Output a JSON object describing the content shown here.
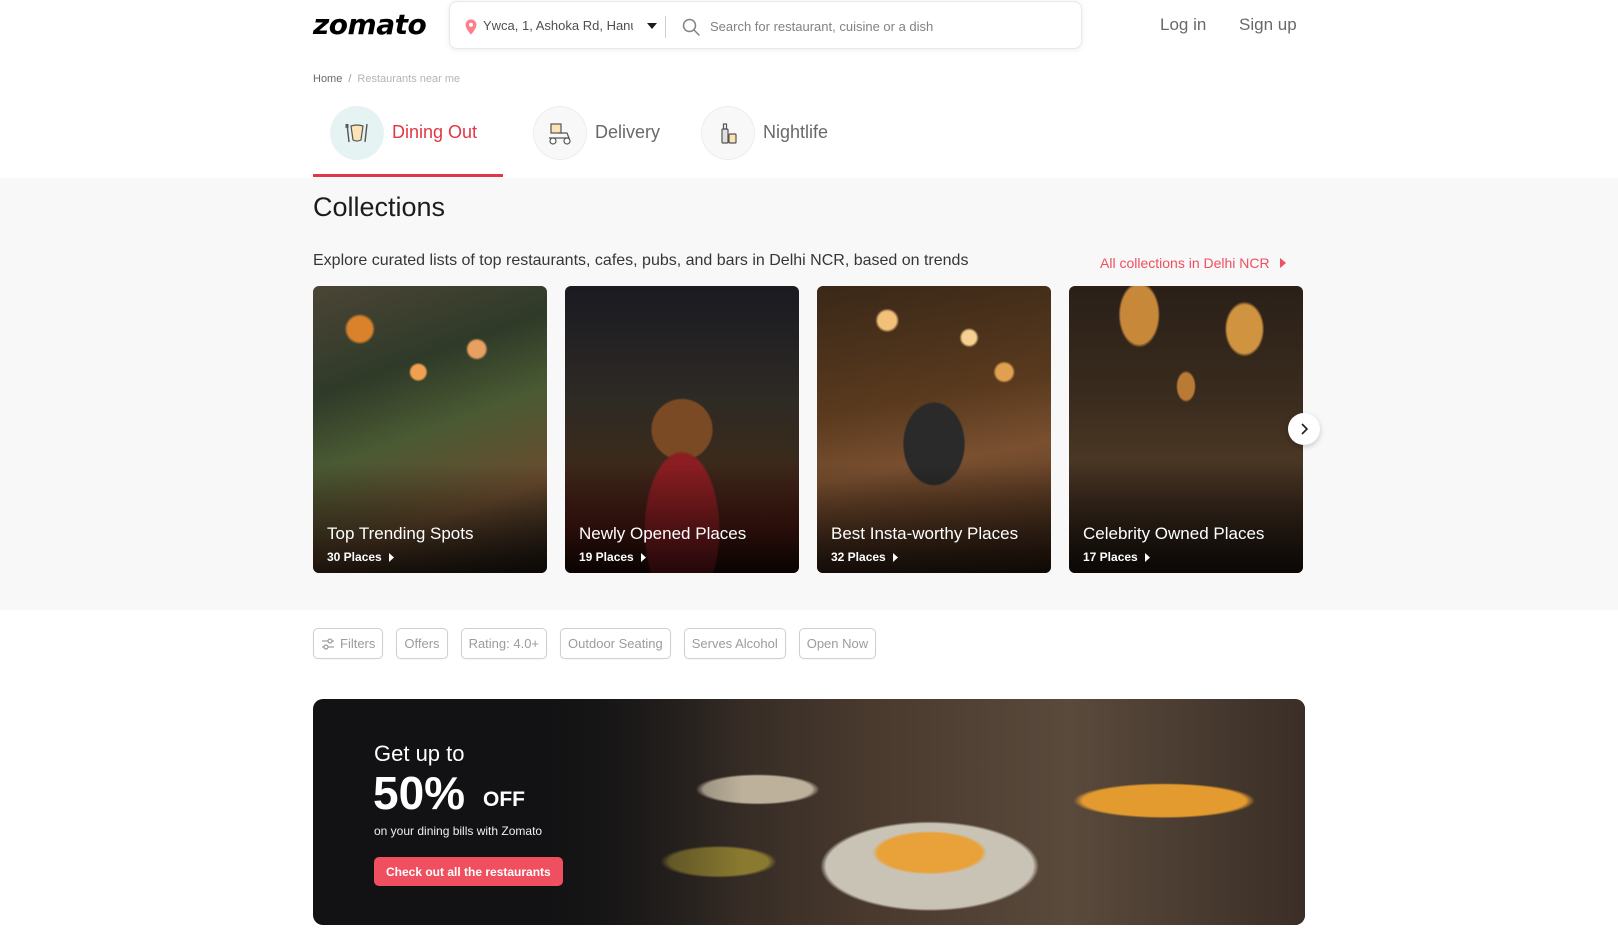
{
  "header": {
    "logo": "zomato",
    "location": "Ywca, 1, Ashoka Rd, Hanu",
    "search_placeholder": "Search for restaurant, cuisine or a dish",
    "login": "Log in",
    "signup": "Sign up"
  },
  "breadcrumb": {
    "home": "Home",
    "separator": "/",
    "current": "Restaurants near me"
  },
  "tabs": [
    {
      "label": "Dining Out",
      "icon": "dining-icon",
      "active": true
    },
    {
      "label": "Delivery",
      "icon": "delivery-icon",
      "active": false
    },
    {
      "label": "Nightlife",
      "icon": "nightlife-icon",
      "active": false
    }
  ],
  "collections": {
    "title": "Collections",
    "subtitle": "Explore curated lists of top restaurants, cafes, pubs, and bars in Delhi NCR, based on trends",
    "all_link": "All collections in Delhi NCR",
    "cards": [
      {
        "title": "Top Trending Spots",
        "count": "30 Places"
      },
      {
        "title": "Newly Opened Places",
        "count": "19 Places"
      },
      {
        "title": "Best Insta-worthy Places",
        "count": "32 Places"
      },
      {
        "title": "Celebrity Owned Places",
        "count": "17 Places"
      }
    ]
  },
  "filters": [
    "Filters",
    "Offers",
    "Rating: 4.0+",
    "Outdoor Seating",
    "Serves Alcohol",
    "Open Now"
  ],
  "banner": {
    "line1": "Get up to",
    "big": "50%",
    "off": "OFF",
    "sub": "on your dining bills with Zomato",
    "cta": "Check out all the restaurants"
  },
  "colors": {
    "brand": "#e23744",
    "accent": "#ef4f5f",
    "text": "#1c1c1c",
    "muted": "#696969"
  }
}
